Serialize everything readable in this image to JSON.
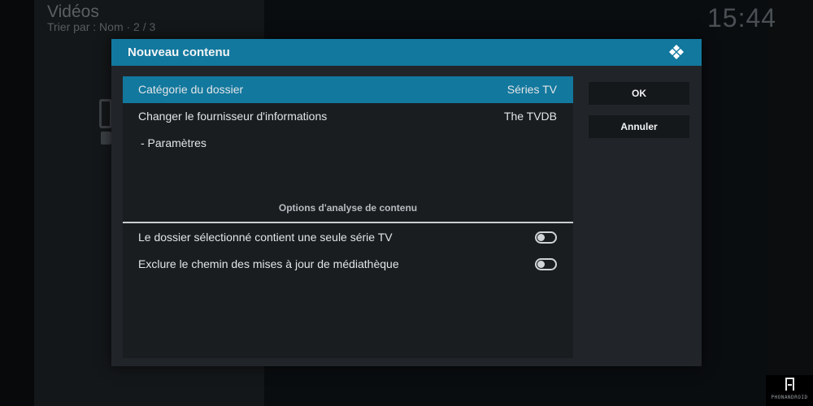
{
  "background": {
    "title": "Vidéos",
    "subtitle": "Trier par : Nom  ·  2 / 3",
    "clock": "15:44"
  },
  "dialog": {
    "title": "Nouveau contenu",
    "rows": [
      {
        "label": "Catégorie du dossier",
        "value": "Séries TV"
      },
      {
        "label": "Changer le fournisseur d'informations",
        "value": "The TVDB"
      },
      {
        "label": "- Paramètres"
      }
    ],
    "section_heading": "Options d'analyse de contenu",
    "toggles": [
      {
        "label": "Le dossier sélectionné contient une seule série TV",
        "state": "off"
      },
      {
        "label": "Exclure le chemin des mises à jour de médiathèque",
        "state": "off"
      }
    ],
    "buttons": {
      "ok": "OK",
      "cancel": "Annuler"
    }
  },
  "watermark": {
    "text": "PHONANDROID"
  },
  "colors": {
    "accent": "#12789e",
    "dialog_bg": "#212529",
    "list_bg": "#1a1d20"
  }
}
